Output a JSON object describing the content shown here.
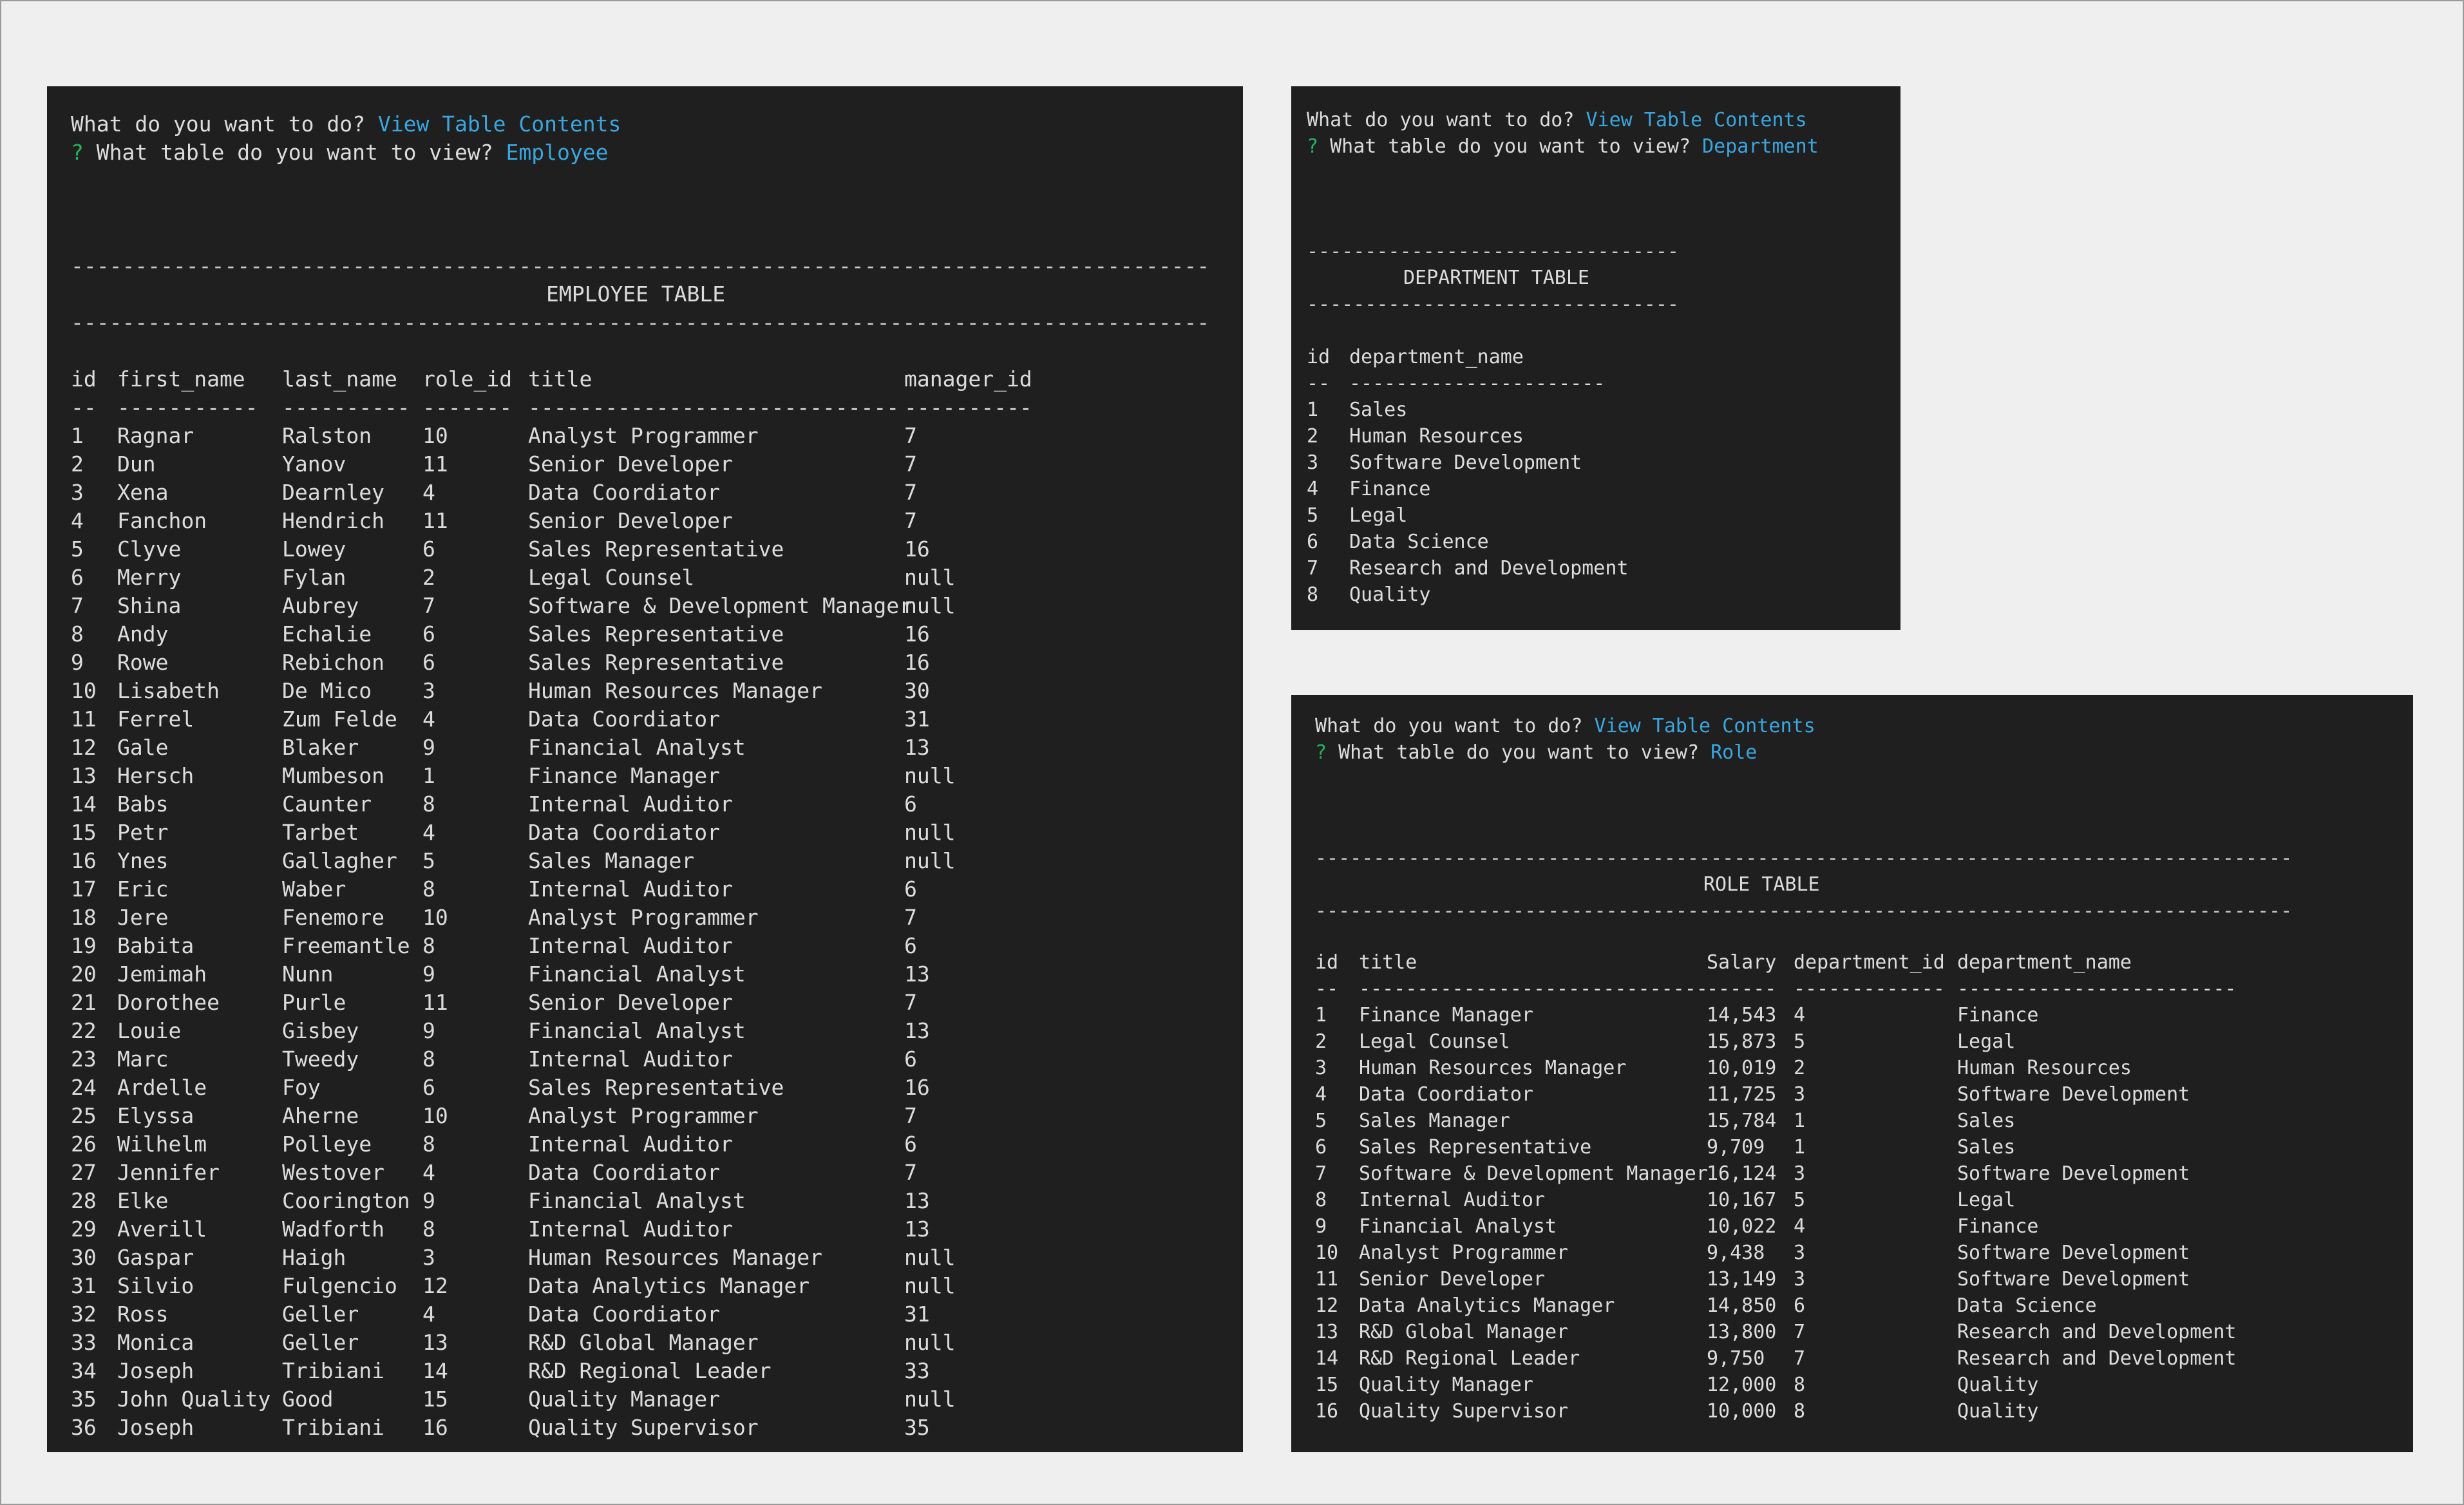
{
  "employee_term": {
    "prompt1": "What do you want to do?",
    "answer1": "View Table Contents",
    "qmark": "?",
    "prompt2": "What table do you want to view?",
    "answer2": "Employee",
    "separator": "------------------------------------------------------------------------------------------------------------------",
    "table_title": "EMPLOYEE TABLE",
    "headers": [
      "id",
      "first_name",
      "last_name",
      "role_id",
      "title",
      "manager_id"
    ],
    "header_underlines": [
      "--",
      "-----------",
      "----------",
      "-------",
      "-----------------------------",
      "----------"
    ],
    "rows": [
      [
        "1",
        "Ragnar",
        "Ralston",
        "10",
        "Analyst Programmer",
        "7"
      ],
      [
        "2",
        "Dun",
        "Yanov",
        "11",
        "Senior Developer",
        "7"
      ],
      [
        "3",
        "Xena",
        "Dearnley",
        "4",
        "Data Coordiator",
        "7"
      ],
      [
        "4",
        "Fanchon",
        "Hendrich",
        "11",
        "Senior Developer",
        "7"
      ],
      [
        "5",
        "Clyve",
        "Lowey",
        "6",
        "Sales Representative",
        "16"
      ],
      [
        "6",
        "Merry",
        "Fylan",
        "2",
        "Legal Counsel",
        "null"
      ],
      [
        "7",
        "Shina",
        "Aubrey",
        "7",
        "Software & Development Manager",
        "null"
      ],
      [
        "8",
        "Andy",
        "Echalie",
        "6",
        "Sales Representative",
        "16"
      ],
      [
        "9",
        "Rowe",
        "Rebichon",
        "6",
        "Sales Representative",
        "16"
      ],
      [
        "10",
        "Lisabeth",
        "De Mico",
        "3",
        "Human Resources Manager",
        "30"
      ],
      [
        "11",
        "Ferrel",
        "Zum Felde",
        "4",
        "Data Coordiator",
        "31"
      ],
      [
        "12",
        "Gale",
        "Blaker",
        "9",
        "Financial Analyst",
        "13"
      ],
      [
        "13",
        "Hersch",
        "Mumbeson",
        "1",
        "Finance Manager",
        "null"
      ],
      [
        "14",
        "Babs",
        "Caunter",
        "8",
        "Internal Auditor",
        "6"
      ],
      [
        "15",
        "Petr",
        "Tarbet",
        "4",
        "Data Coordiator",
        "null"
      ],
      [
        "16",
        "Ynes",
        "Gallagher",
        "5",
        "Sales Manager",
        "null"
      ],
      [
        "17",
        "Eric",
        "Waber",
        "8",
        "Internal Auditor",
        "6"
      ],
      [
        "18",
        "Jere",
        "Fenemore",
        "10",
        "Analyst Programmer",
        "7"
      ],
      [
        "19",
        "Babita",
        "Freemantle",
        "8",
        "Internal Auditor",
        "6"
      ],
      [
        "20",
        "Jemimah",
        "Nunn",
        "9",
        "Financial Analyst",
        "13"
      ],
      [
        "21",
        "Dorothee",
        "Purle",
        "11",
        "Senior Developer",
        "7"
      ],
      [
        "22",
        "Louie",
        "Gisbey",
        "9",
        "Financial Analyst",
        "13"
      ],
      [
        "23",
        "Marc",
        "Tweedy",
        "8",
        "Internal Auditor",
        "6"
      ],
      [
        "24",
        "Ardelle",
        "Foy",
        "6",
        "Sales Representative",
        "16"
      ],
      [
        "25",
        "Elyssa",
        "Aherne",
        "10",
        "Analyst Programmer",
        "7"
      ],
      [
        "26",
        "Wilhelm",
        "Polleye",
        "8",
        "Internal Auditor",
        "6"
      ],
      [
        "27",
        "Jennifer",
        "Westover",
        "4",
        "Data Coordiator",
        "7"
      ],
      [
        "28",
        "Elke",
        "Coorington",
        "9",
        "Financial Analyst",
        "13"
      ],
      [
        "29",
        "Averill",
        "Wadforth",
        "8",
        "Internal Auditor",
        "13"
      ],
      [
        "30",
        "Gaspar",
        "Haigh",
        "3",
        "Human Resources Manager",
        "null"
      ],
      [
        "31",
        "Silvio",
        "Fulgencio",
        "12",
        "Data Analytics Manager",
        "null"
      ],
      [
        "32",
        "Ross",
        "Geller",
        "4",
        "Data Coordiator",
        "31"
      ],
      [
        "33",
        "Monica",
        "Geller",
        "13",
        "R&D Global Manager",
        "null"
      ],
      [
        "34",
        "Joseph",
        "Tribiani",
        "14",
        "R&D Regional Leader",
        "33"
      ],
      [
        "35",
        "John Quality",
        "Good",
        "15",
        "Quality Manager",
        "null"
      ],
      [
        "36",
        "Joseph",
        "Tribiani",
        "16",
        "Quality Supervisor",
        "35"
      ]
    ]
  },
  "department_term": {
    "prompt1": "What do you want to do?",
    "answer1": "View Table Contents",
    "qmark": "?",
    "prompt2": "What table do you want to view?",
    "answer2": "Department",
    "separator": "--------------------------------",
    "table_title": "DEPARTMENT TABLE",
    "headers": [
      "id",
      "department_name"
    ],
    "header_underlines": [
      "--",
      "----------------------"
    ],
    "rows": [
      [
        "1",
        "Sales"
      ],
      [
        "2",
        "Human Resources"
      ],
      [
        "3",
        "Software Development"
      ],
      [
        "4",
        "Finance"
      ],
      [
        "5",
        "Legal"
      ],
      [
        "6",
        "Data Science"
      ],
      [
        "7",
        "Research and Development"
      ],
      [
        "8",
        "Quality"
      ]
    ]
  },
  "role_term": {
    "prompt1": "What do you want to do?",
    "answer1": "View Table Contents",
    "qmark": "?",
    "prompt2": "What table do you want to view?",
    "answer2": "Role",
    "separator": "------------------------------------------------------------------------------------------",
    "table_title": "ROLE TABLE",
    "headers": [
      "id",
      "title",
      "Salary",
      "department_id",
      "department_name"
    ],
    "header_underlines": [
      "--",
      "------------------------------",
      "------",
      "-------------",
      "------------------------"
    ],
    "rows": [
      [
        "1",
        "Finance Manager",
        "14,543",
        "4",
        "Finance"
      ],
      [
        "2",
        "Legal Counsel",
        "15,873",
        "5",
        "Legal"
      ],
      [
        "3",
        "Human Resources Manager",
        "10,019",
        "2",
        "Human Resources"
      ],
      [
        "4",
        "Data Coordiator",
        "11,725",
        "3",
        "Software Development"
      ],
      [
        "5",
        "Sales Manager",
        "15,784",
        "1",
        "Sales"
      ],
      [
        "6",
        "Sales Representative",
        "9,709",
        "1",
        "Sales"
      ],
      [
        "7",
        "Software & Development Manager",
        "16,124",
        "3",
        "Software Development"
      ],
      [
        "8",
        "Internal Auditor",
        "10,167",
        "5",
        "Legal"
      ],
      [
        "9",
        "Financial Analyst",
        "10,022",
        "4",
        "Finance"
      ],
      [
        "10",
        "Analyst Programmer",
        "9,438",
        "3",
        "Software Development"
      ],
      [
        "11",
        "Senior Developer",
        "13,149",
        "3",
        "Software Development"
      ],
      [
        "12",
        "Data Analytics Manager",
        "14,850",
        "6",
        "Data Science"
      ],
      [
        "13",
        "R&D Global Manager",
        "13,800",
        "7",
        "Research and Development"
      ],
      [
        "14",
        "R&D Regional Leader",
        "9,750",
        "7",
        "Research and Development"
      ],
      [
        "15",
        "Quality Manager",
        "12,000",
        "8",
        "Quality"
      ],
      [
        "16",
        "Quality Supervisor",
        "10,000",
        "8",
        "Quality"
      ]
    ]
  },
  "colors": {
    "terminal_bg": "#1f1f1f",
    "text": "#dcdcdc",
    "answer": "#3aa6e0",
    "question_mark": "#23b35a",
    "page_bg": "#efefef"
  }
}
